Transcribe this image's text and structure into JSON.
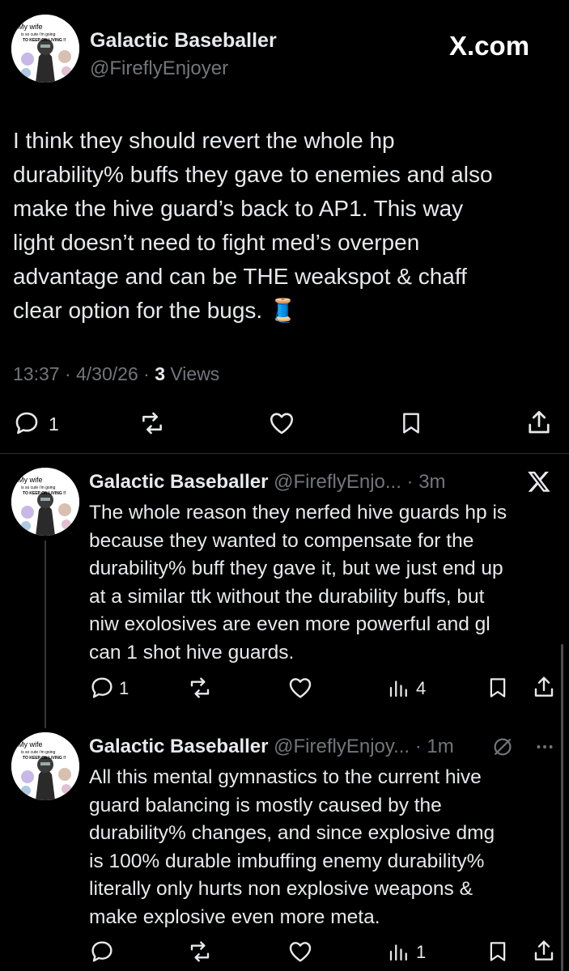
{
  "main_post": {
    "display_name": "Galactic Baseballer",
    "handle": "@FireflyEnjoyer",
    "source_label": "X.com",
    "avatar_text_1": "My wife",
    "avatar_text_2": "is so cute i'm going",
    "avatar_text_3": "TO KEEP ON LIVING !!",
    "text": "I think they should revert the whole hp\ndurability% buffs they gave to enemies and also\nmake the hive guard’s back to AP1. This way\nlight doesn’t need to fight med’s overpen\nadvantage and can be THE weakspot & chaff\nclear option for the bugs. 🧵",
    "time": "13:37 · 4/30/26 · ",
    "views_count": "3",
    "views_label": " Views",
    "reply_count": "1"
  },
  "replies": [
    {
      "display_name": "Galactic Baseballer",
      "handle_time": "@FireflyEnjo... · 3m",
      "text": "The whole reason they nerfed hive guards hp is\nbecause they wanted to compensate for the\ndurability% buff they gave it, but we just end up\nat a similar ttk without the durability buffs, but\nniw exolosives are even more powerful and gl\ncan 1 shot hive guards.",
      "reply_count": "1",
      "views_count": "4"
    },
    {
      "display_name": "Galactic Baseballer",
      "handle_time": "@FireflyEnjoy... · 1m",
      "text": "All this mental gymnastics to the current hive\nguard balancing is mostly caused by the\ndurability% changes, and since explosive dmg\nis 100% durable imbuffing enemy durability%\nliterally only hurts non explosive weapons &\nmake explosive even more meta.",
      "views_count": "1"
    }
  ],
  "colors": {
    "background": "#000000",
    "text": "#e7e9ea",
    "muted": "#71767b",
    "divider": "#2f3336"
  }
}
